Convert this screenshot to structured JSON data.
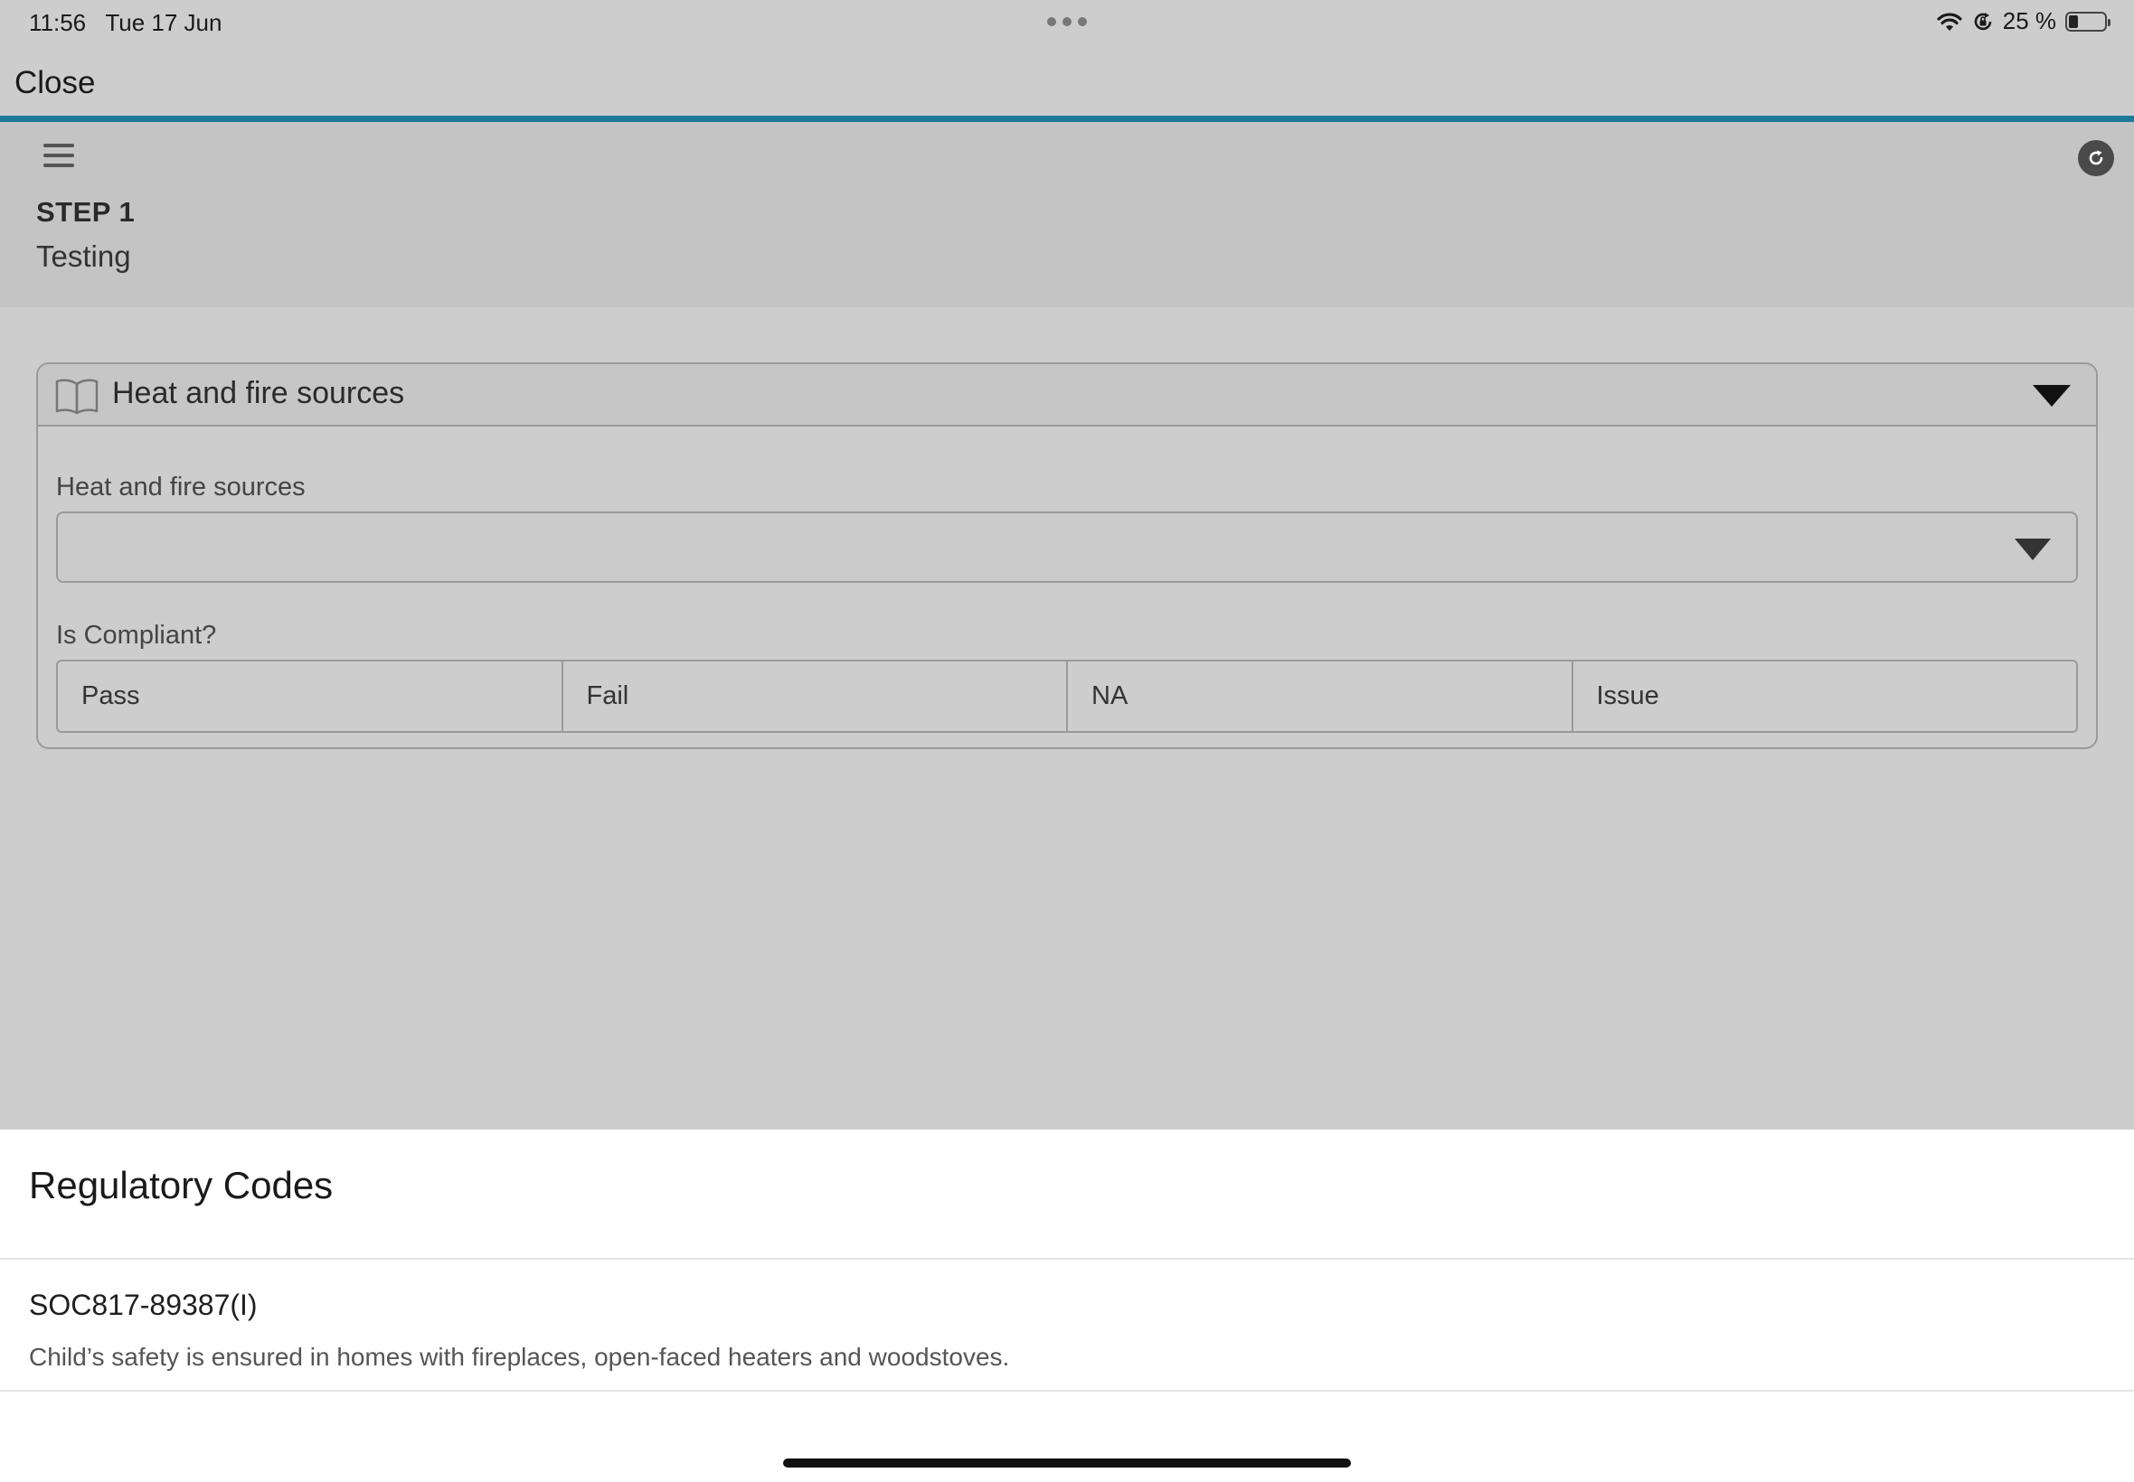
{
  "status_bar": {
    "time": "11:56",
    "date": "Tue 17 Jun",
    "battery": "25 %",
    "battery_level": 0.25,
    "icons": [
      "wifi-icon",
      "orientation-lock-icon",
      "battery-icon"
    ]
  },
  "nav": {
    "close_label": "Close",
    "accent_color": "#1c7a98"
  },
  "header": {
    "step_label": "STEP 1",
    "step_title": "Testing",
    "icons": [
      "menu-icon",
      "refresh-icon"
    ]
  },
  "card": {
    "title": "Heat and fire sources",
    "icon": "book-icon",
    "select_label": "Heat and fire sources",
    "select_value": "",
    "compliance_label": "Is Compliant?",
    "compliance_options": [
      "Pass",
      "Fail",
      "NA",
      "Issue"
    ]
  },
  "regulatory": {
    "title": "Regulatory Codes",
    "codes": [
      {
        "id": "SOC817-89387(I)",
        "description": "Child’s safety is ensured in homes with fireplaces, open-faced heaters and woodstoves."
      }
    ]
  }
}
